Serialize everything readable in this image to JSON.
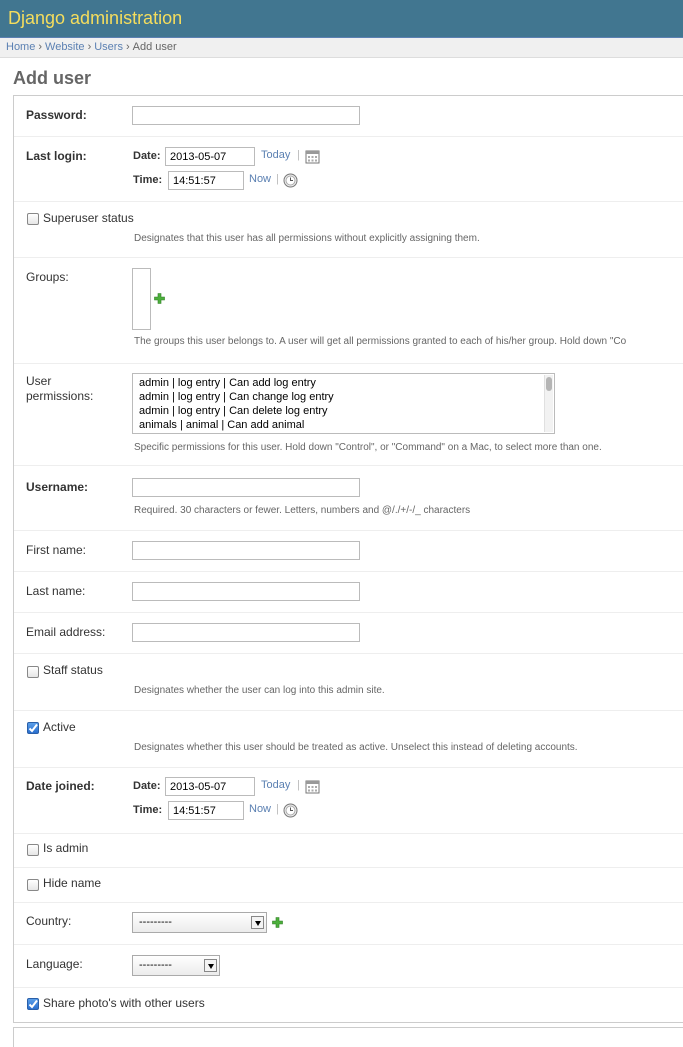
{
  "header": {
    "site_name": "Django administration"
  },
  "breadcrumbs": {
    "home": "Home",
    "app": "Website",
    "model": "Users",
    "current": "Add user",
    "separator": "›"
  },
  "page": {
    "title": "Add user"
  },
  "form": {
    "password": {
      "label": "Password:",
      "value": ""
    },
    "last_login": {
      "label": "Last login:",
      "date_label": "Date:",
      "date_value": "2013-05-07",
      "today_link": "Today",
      "time_label": "Time:",
      "time_value": "14:51:57",
      "now_link": "Now",
      "separator": "|"
    },
    "superuser": {
      "label": "Superuser status",
      "checked": false,
      "help": "Designates that this user has all permissions without explicitly assigning them."
    },
    "groups": {
      "label": "Groups:",
      "help": "The groups this user belongs to. A user will get all permissions granted to each of his/her group. Hold down \"Co"
    },
    "user_permissions": {
      "label_line1": "User",
      "label_line2": "permissions:",
      "options": [
        "admin | log entry | Can add log entry",
        "admin | log entry | Can change log entry",
        "admin | log entry | Can delete log entry",
        "animals | animal | Can add animal"
      ],
      "help": "Specific permissions for this user. Hold down \"Control\", or \"Command\" on a Mac, to select more than one."
    },
    "username": {
      "label": "Username:",
      "value": "",
      "help": "Required. 30 characters or fewer. Letters, numbers and @/./+/-/_ characters"
    },
    "first_name": {
      "label": "First name:",
      "value": ""
    },
    "last_name": {
      "label": "Last name:",
      "value": ""
    },
    "email": {
      "label": "Email address:",
      "value": ""
    },
    "staff": {
      "label": "Staff status",
      "checked": false,
      "help": "Designates whether the user can log into this admin site."
    },
    "active": {
      "label": "Active",
      "checked": true,
      "help": "Designates whether this user should be treated as active. Unselect this instead of deleting accounts."
    },
    "date_joined": {
      "label": "Date joined:",
      "date_label": "Date:",
      "date_value": "2013-05-07",
      "today_link": "Today",
      "time_label": "Time:",
      "time_value": "14:51:57",
      "now_link": "Now",
      "separator": "|"
    },
    "is_admin": {
      "label": "Is admin",
      "checked": false
    },
    "hide_name": {
      "label": "Hide name",
      "checked": false
    },
    "country": {
      "label": "Country:",
      "selected": "---------"
    },
    "language": {
      "label": "Language:",
      "selected": "---------"
    },
    "share_photos": {
      "label": "Share photo's with other users",
      "checked": true
    }
  },
  "colors": {
    "header_bg": "#417690",
    "site_name": "#f5dd5d",
    "link": "#5b80b2",
    "add_icon": "#3a9a2e"
  },
  "icons": {
    "calendar": "calendar-icon",
    "clock": "clock-icon",
    "add": "add-related-icon",
    "checkmark": "checkmark-icon"
  }
}
